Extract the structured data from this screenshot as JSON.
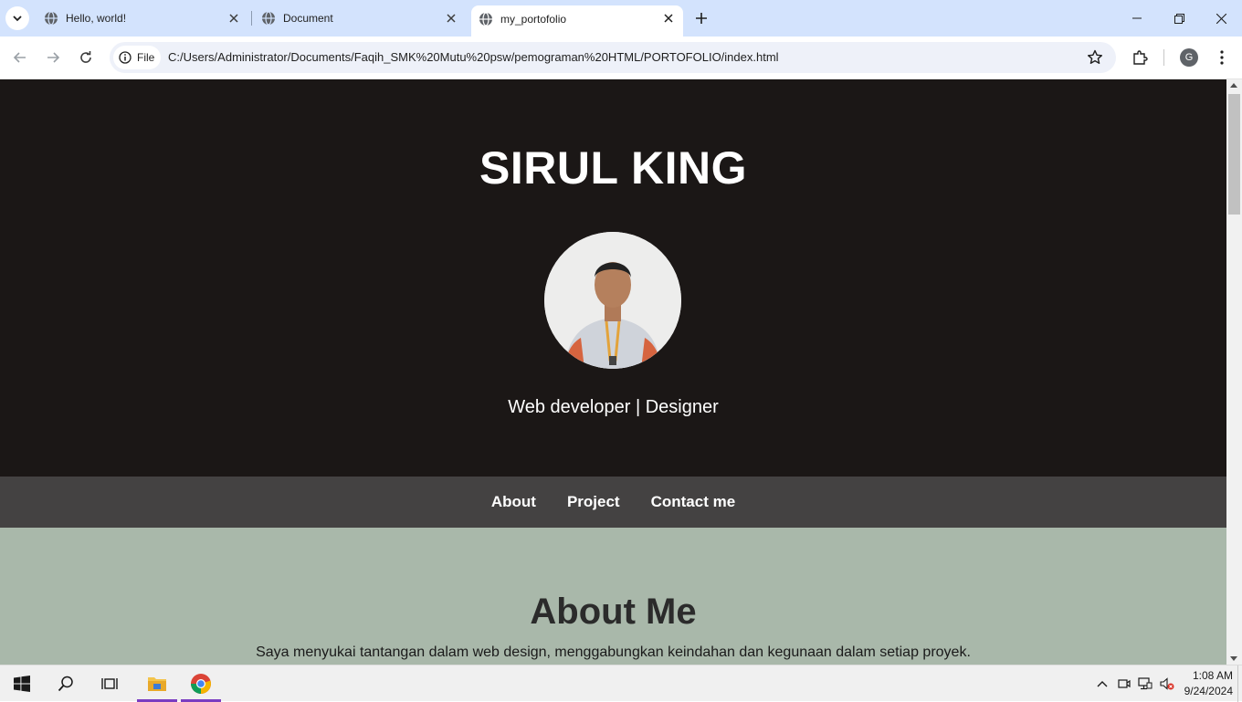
{
  "browser": {
    "tabs": [
      {
        "title": "Hello, world!",
        "active": false
      },
      {
        "title": "Document",
        "active": false
      },
      {
        "title": "my_portofolio",
        "active": true
      }
    ],
    "site_info_label": "File",
    "url": "C:/Users/Administrator/Documents/Faqih_SMK%20Mutu%20psw/pemograman%20HTML/PORTOFOLIO/index.html",
    "profile_initial": "G"
  },
  "page": {
    "hero": {
      "name": "SIRUL KING",
      "tagline": "Web developer | Designer"
    },
    "nav": {
      "items": [
        "About",
        "Project",
        "Contact me"
      ]
    },
    "about": {
      "heading": "About Me",
      "text": "Saya menyukai tantangan dalam web design, menggabungkan keindahan dan kegunaan dalam setiap proyek."
    }
  },
  "taskbar": {
    "time": "1:08 AM",
    "date": "9/24/2024"
  },
  "colors": {
    "hero_bg": "#1b1716",
    "nav_bg": "#444242",
    "about_bg": "#a9b8aa",
    "tabstrip_bg": "#d3e3fd",
    "taskbar_accent": "#7a3cc1"
  }
}
